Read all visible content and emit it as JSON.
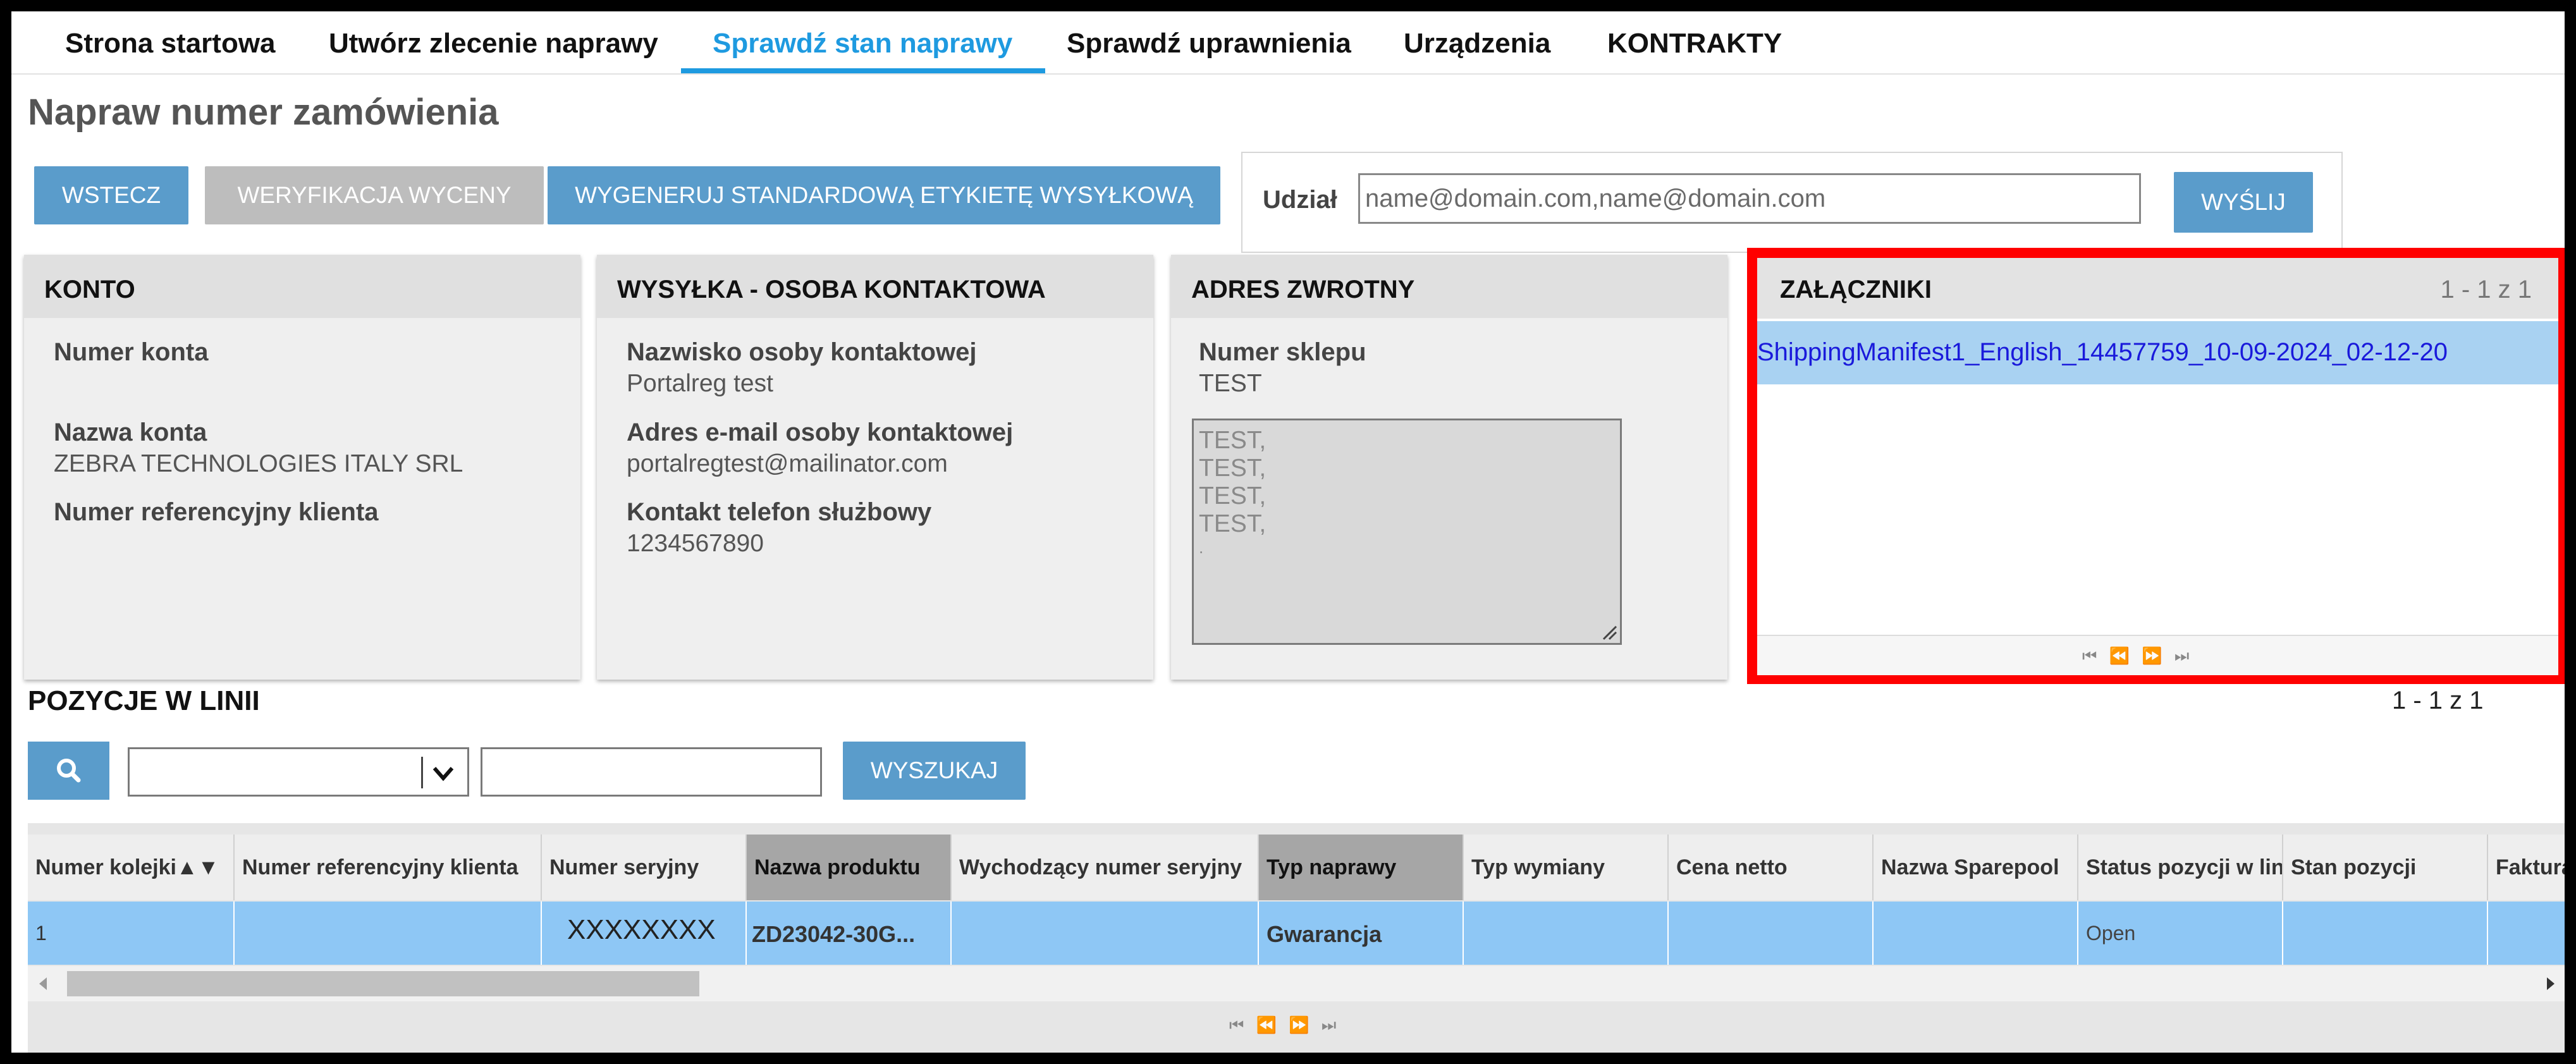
{
  "nav": {
    "tabs": [
      {
        "label": "Strona startowa"
      },
      {
        "label": "Utwórz zlecenie naprawy"
      },
      {
        "label": "Sprawdź stan naprawy",
        "active": true
      },
      {
        "label": "Sprawdź uprawnienia"
      },
      {
        "label": "Urządzenia"
      },
      {
        "label": "KONTRAKTY"
      }
    ]
  },
  "page": {
    "title": "Napraw numer zamówienia"
  },
  "actions": {
    "back": "WSTECZ",
    "verify_quote": "WERYFIKACJA WYCENY",
    "generate_label": "WYGENERUJ STANDARDOWĄ ETYKIETĘ WYSYŁKOWĄ"
  },
  "share": {
    "label": "Udział",
    "placeholder": "name@domain.com,name@domain.com",
    "value": "",
    "send": "WYŚLIJ"
  },
  "account": {
    "title": "KONTO",
    "number_label": "Numer konta",
    "number_value": "",
    "name_label": "Nazwa konta",
    "name_value": "ZEBRA TECHNOLOGIES ITALY SRL",
    "ref_label": "Numer referencyjny klienta",
    "ref_value": ""
  },
  "shipping": {
    "title": "WYSYŁKA - OSOBA KONTAKTOWA",
    "contact_label": "Nazwisko osoby kontaktowej",
    "contact_value": "Portalreg test",
    "email_label": "Adres e-mail osoby kontaktowej",
    "email_value": "portalregtest@mailinator.com",
    "phone_label": "Kontakt telefon służbowy",
    "phone_value": "1234567890"
  },
  "return_address": {
    "title": "ADRES ZWROTNY",
    "store_label": "Numer sklepu",
    "store_value": "TEST",
    "address_lines": [
      "TEST,",
      "TEST,",
      "TEST,",
      "TEST,",
      "."
    ]
  },
  "attachments": {
    "title": "ZAŁĄCZNIKI",
    "counter": "1 - 1 z 1",
    "items": [
      {
        "name": "ShippingManifest1_English_14457759_10-09-2024_02-12-20"
      }
    ],
    "pager": "⏮ ⏪ ⏩ ⏭"
  },
  "line_items": {
    "title": "POZYCJE W LINII",
    "counter": "1 - 1 z 1",
    "search_button": "WYSZUKAJ",
    "columns": [
      "Numer kolejki▲▼",
      "Numer referencyjny klienta",
      "Numer seryjny",
      "Nazwa produktu",
      "Wychodzący numer seryjny",
      "Typ naprawy",
      "Typ wymiany",
      "Cena netto",
      "Nazwa Sparepool",
      "Status pozycji w linii",
      "Stan pozycji",
      "Faktura"
    ],
    "rows": [
      [
        "1",
        "",
        "XXXXXXXX",
        "ZD23042-30G...",
        "",
        "Gwarancja",
        "",
        "",
        "",
        "Open",
        "",
        ""
      ]
    ],
    "pager": "⏮ ⏪ ⏩ ⏭"
  },
  "colors": {
    "accent": "#1e9ae0",
    "button": "#5a9ccb",
    "selected_row": "#8ec7f5",
    "highlight": "#ff0000"
  }
}
